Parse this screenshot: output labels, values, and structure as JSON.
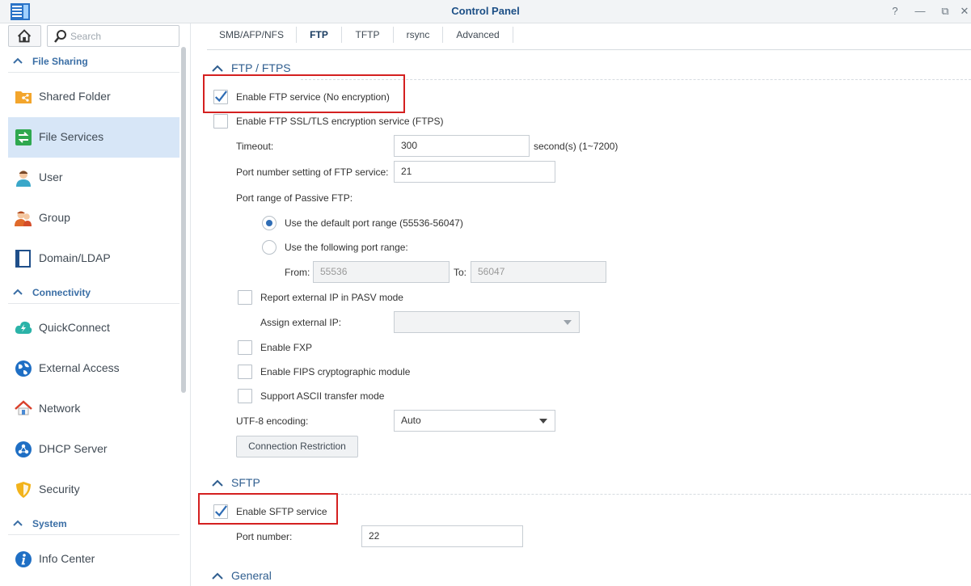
{
  "window": {
    "title": "Control Panel",
    "controls": {
      "help": "?",
      "minimize": "—",
      "restore": "⧉",
      "close": "✕"
    }
  },
  "sidebar": {
    "search_placeholder": "Search",
    "sections": [
      {
        "label": "File Sharing",
        "items": [
          "Shared Folder",
          "File Services",
          "User",
          "Group",
          "Domain/LDAP"
        ]
      },
      {
        "label": "Connectivity",
        "items": [
          "QuickConnect",
          "External Access",
          "Network",
          "DHCP Server",
          "Security"
        ]
      },
      {
        "label": "System",
        "items": [
          "Info Center"
        ]
      }
    ],
    "active_item": "File Services"
  },
  "tabs": [
    "SMB/AFP/NFS",
    "FTP",
    "TFTP",
    "rsync",
    "Advanced"
  ],
  "active_tab": "FTP",
  "ftp": {
    "section_title": "FTP / FTPS",
    "enable_ftp": {
      "label": "Enable FTP service (No encryption)",
      "checked": true
    },
    "enable_ftps": {
      "label": "Enable FTP SSL/TLS encryption service (FTPS)",
      "checked": false
    },
    "timeout": {
      "label": "Timeout:",
      "value": "300",
      "unit": "second(s) (1~7200)"
    },
    "port": {
      "label": "Port number setting of FTP service:",
      "value": "21"
    },
    "passive_label": "Port range of Passive FTP:",
    "passive_default": {
      "label": "Use the default port range (55536-56047)",
      "selected": true
    },
    "passive_custom": {
      "label": "Use the following port range:",
      "selected": false
    },
    "from": {
      "label": "From:",
      "value": "55536"
    },
    "to": {
      "label": "To:",
      "value": "56047"
    },
    "report_external_ip": {
      "label": "Report external IP in PASV mode",
      "checked": false
    },
    "assign_external_ip": {
      "label": "Assign external IP:",
      "value": ""
    },
    "enable_fxp": {
      "label": "Enable FXP",
      "checked": false
    },
    "enable_fips": {
      "label": "Enable FIPS cryptographic module",
      "checked": false
    },
    "ascii_mode": {
      "label": "Support ASCII transfer mode",
      "checked": false
    },
    "utf8": {
      "label": "UTF-8 encoding:",
      "value": "Auto"
    },
    "connection_restriction": "Connection Restriction"
  },
  "sftp": {
    "section_title": "SFTP",
    "enable_sftp": {
      "label": "Enable SFTP service",
      "checked": true
    },
    "port": {
      "label": "Port number:",
      "value": "22"
    }
  },
  "general": {
    "section_title": "General"
  },
  "colors": {
    "accent": "#2f6db5",
    "highlight": "#d42020",
    "active_nav": "#d7e6f7"
  }
}
